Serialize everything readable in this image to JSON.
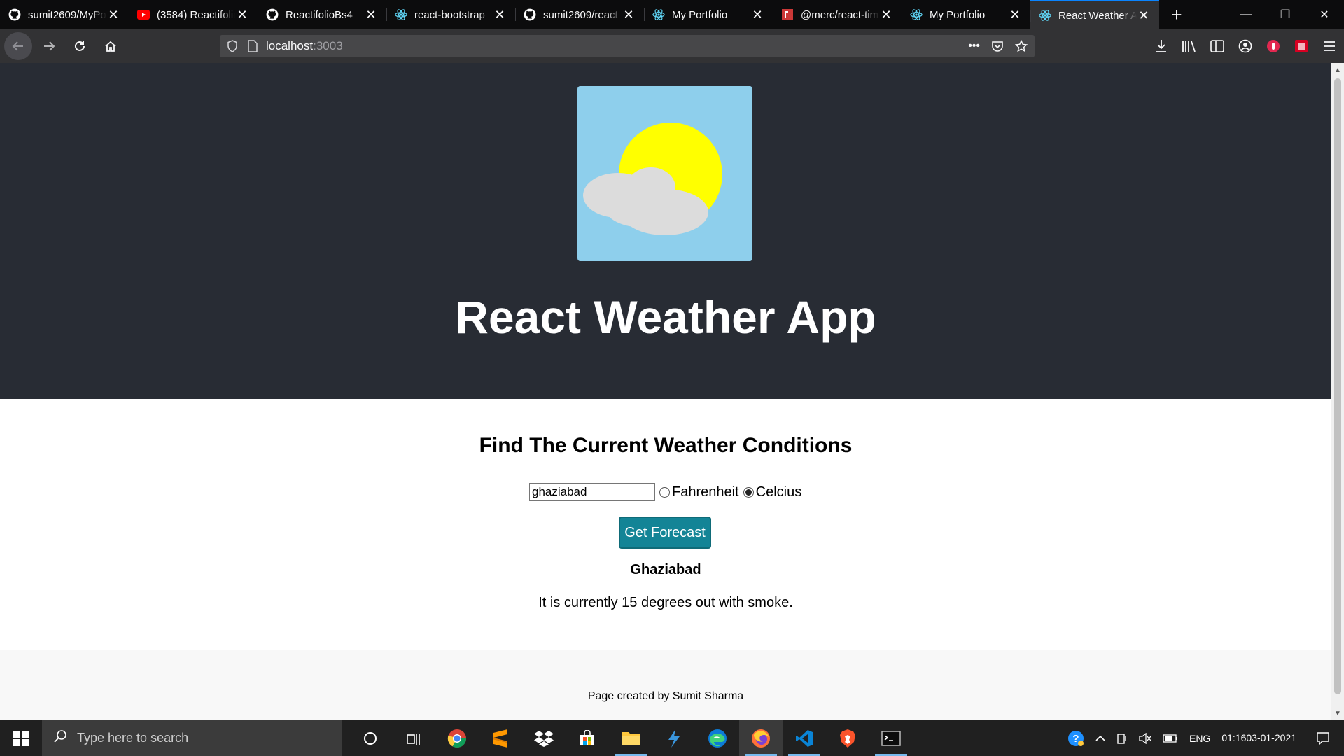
{
  "browser": {
    "tabs": [
      {
        "title": "sumit2609/MyPortfolio",
        "icon": "github-icon"
      },
      {
        "title": "(3584) Reactifolio",
        "icon": "youtube-icon"
      },
      {
        "title": "ReactifolioBs4_",
        "icon": "github-icon"
      },
      {
        "title": "react-bootstrap",
        "icon": "react-icon"
      },
      {
        "title": "sumit2609/react",
        "icon": "github-icon"
      },
      {
        "title": "My Portfolio",
        "icon": "react-icon"
      },
      {
        "title": "@merc/react-tim",
        "icon": "npm-icon"
      },
      {
        "title": "My Portfolio",
        "icon": "react-icon"
      },
      {
        "title": "React Weather App",
        "icon": "react-icon",
        "active": true
      }
    ],
    "url_host": "localhost",
    "url_port": ":3003"
  },
  "page": {
    "app_title": "React Weather App",
    "form_heading": "Find The Current Weather Conditions",
    "city_value": "ghaziabad",
    "unit_fahrenheit": "Fahrenheit",
    "unit_celcius": "Celcius",
    "selected_unit": "Celcius",
    "button_label": "Get Forecast",
    "result_city": "Ghaziabad",
    "result_text": "It is currently 15 degrees out with smoke.",
    "footer_text": "Page created by Sumit Sharma"
  },
  "taskbar": {
    "search_placeholder": "Type here to search",
    "language": "ENG",
    "time": "01:16",
    "date": "03-01-2021"
  },
  "colors": {
    "hero_bg": "#282c34",
    "logo_sky": "#8ecfec",
    "sun": "#ffff00",
    "cloud": "#dcdcdc",
    "button_bg": "#138496",
    "accent_tab": "#0a84ff"
  }
}
